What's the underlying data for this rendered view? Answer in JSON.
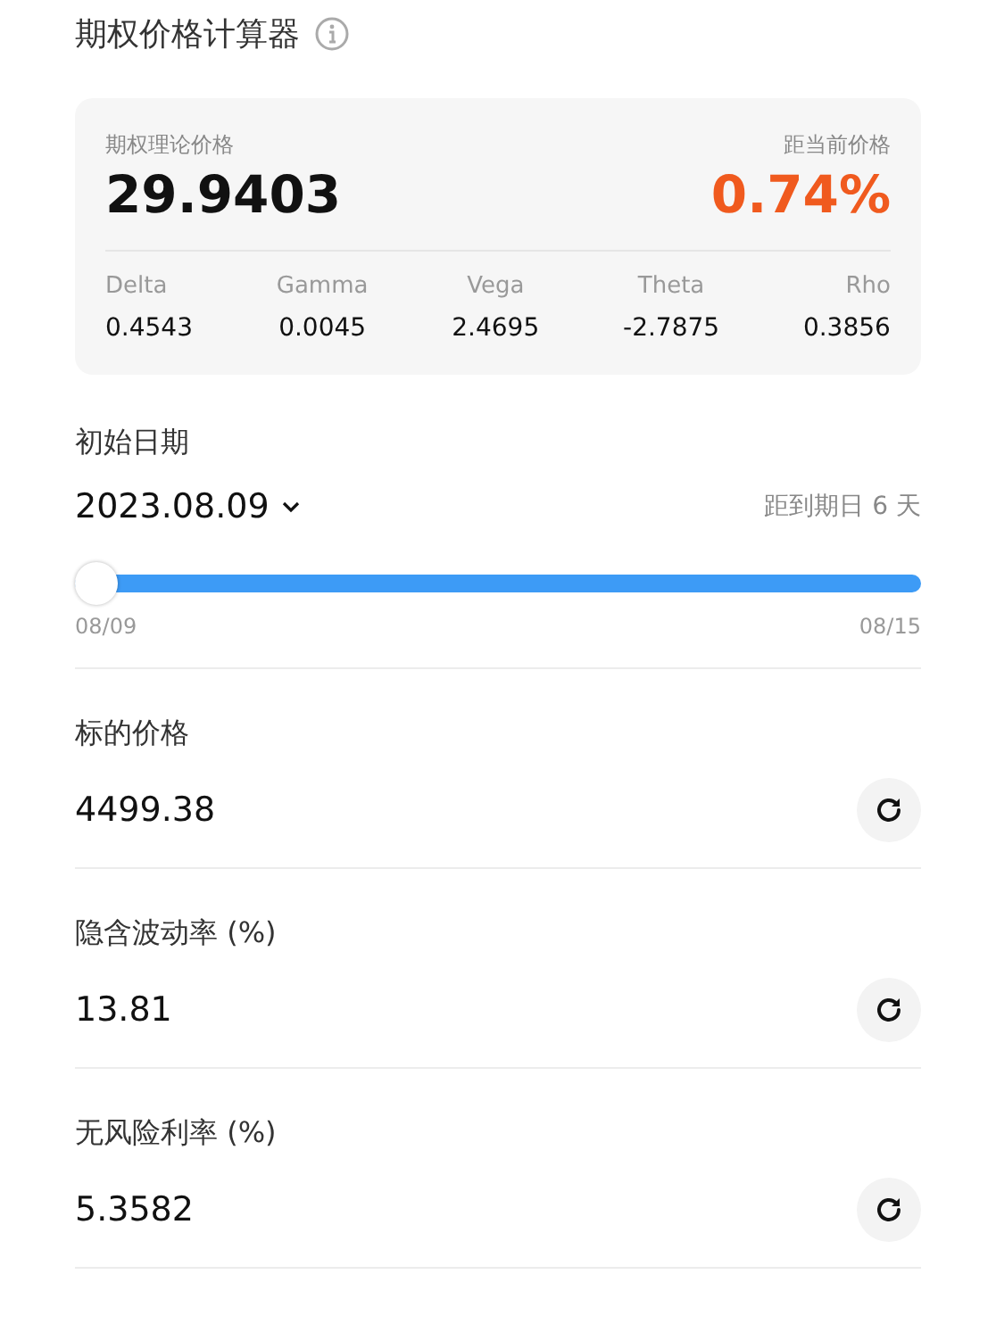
{
  "title": "期权价格计算器",
  "summary": {
    "price_label": "期权理论价格",
    "price": "29.9403",
    "diff_label": "距当前价格",
    "diff": "0.74%",
    "greeks": [
      {
        "name": "Delta",
        "value": "0.4543"
      },
      {
        "name": "Gamma",
        "value": "0.0045"
      },
      {
        "name": "Vega",
        "value": "2.4695"
      },
      {
        "name": "Theta",
        "value": "-2.7875"
      },
      {
        "name": "Rho",
        "value": "0.3856"
      }
    ]
  },
  "start_date": {
    "label": "初始日期",
    "value": "2023.08.09",
    "days_left": "距到期日 6 天",
    "level": 0,
    "range_start": "08/09",
    "range_end": "08/15"
  },
  "fields": [
    {
      "label": "标的价格",
      "value": "4499.38"
    },
    {
      "label": "隐含波动率 (%)",
      "value": "13.81"
    },
    {
      "label": "无风险利率 (%)",
      "value": "5.3582"
    }
  ]
}
